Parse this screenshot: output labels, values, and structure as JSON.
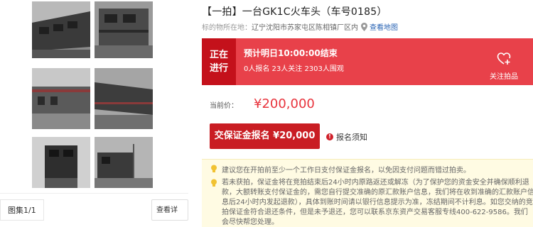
{
  "gallery": {
    "count": "图集1/1",
    "view_detail": "查看详情",
    "thumbnails": [
      "locomotive-thumb-1",
      "locomotive-thumb-2",
      "locomotive-thumb-3",
      "locomotive-thumb-4",
      "locomotive-thumb-5",
      "locomotive-thumb-6"
    ]
  },
  "item": {
    "title": "【一拍】一台GK1C火车头（车号0185）",
    "location_label": "标的物所在地：",
    "location": "辽宁沈阳市苏家屯区陈相镇厂区内",
    "map_link": "查看地图"
  },
  "auction": {
    "status_line1": "正在",
    "status_line2": "进行",
    "countdown": "预计明日10:00:00结束",
    "stats": "0人报名  23人关注  2303人围观",
    "follow_label": "关注拍品"
  },
  "price": {
    "label": "当前价：",
    "value": "¥200,000"
  },
  "actions": {
    "deposit_button": "交保证金报名 ¥20,000",
    "notice": "报名须知"
  },
  "tips": {
    "tip1": "建议您在开拍前至少一个工作日支付保证金报名，以免因支付问题而错过拍卖。",
    "tip2": "若未获拍，保证金将在竞拍结束后24小时内原路返还或解冻（为了保护您的资金安全并确保顺利退款，大额转账支付保证金的，需您自行提交准确的原汇款账户信息，我们将在收到准确的汇款账户信息后24小时内发起退款），具体到账时间请以银行信息提示为准，冻结期间不计利息。如您交纳的竞拍保证金符合退还条件，但是未予退还，您可以联系京东资产交易客服专线400-622-9586。我们会尽快帮您处理。"
  },
  "colors": {
    "accent": "#e8414a",
    "status_dark": "#c4111b",
    "price": "#e8333c",
    "button": "#c91d23",
    "tips_bg": "#fffbe3",
    "link": "#2a64b4"
  }
}
